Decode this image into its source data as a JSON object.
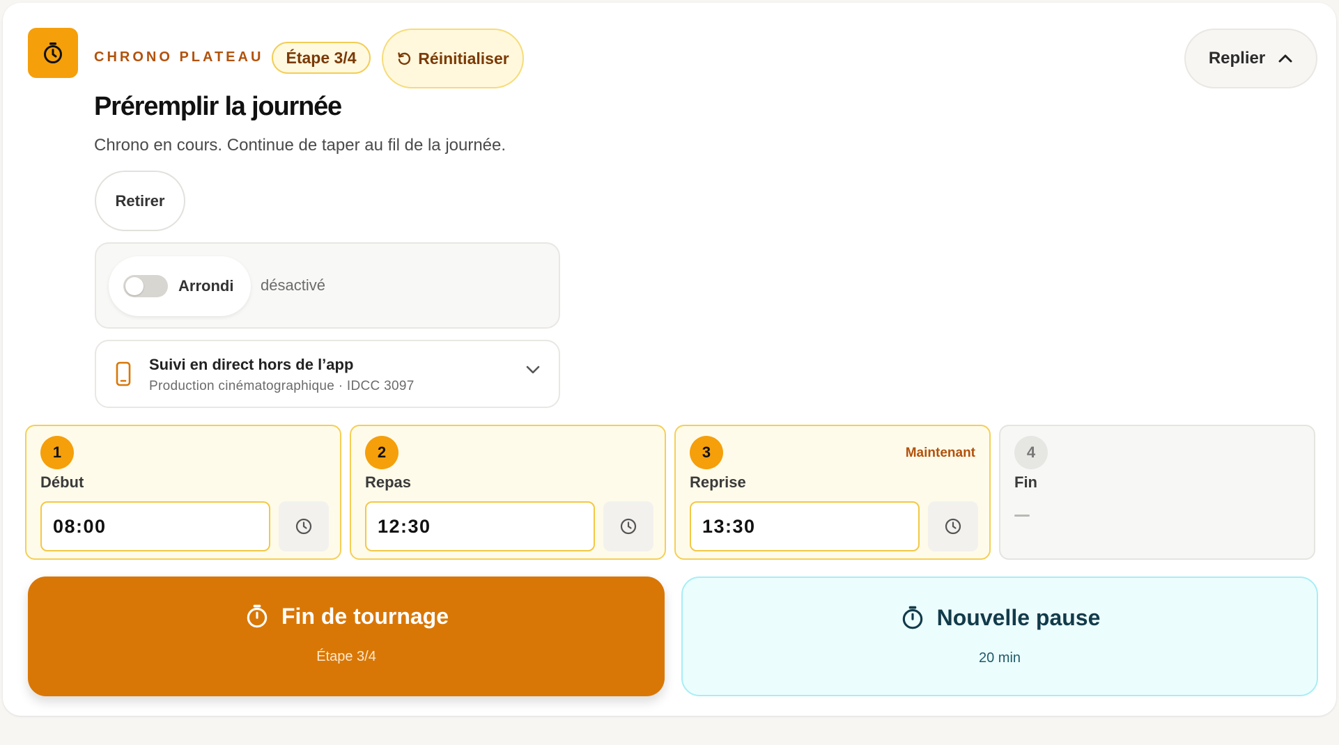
{
  "header": {
    "eyebrow": "CHRONO PLATEAU",
    "step_badge": "Étape 3/4",
    "reset_label": "Réinitialiser",
    "collapse_label": "Replier",
    "title": "Préremplir la journée",
    "subtitle": "Chrono en cours. Continue de taper au fil de la journée."
  },
  "actions": {
    "remove_label": "Retirer"
  },
  "rounding": {
    "label": "Arrondi",
    "state": "désactivé",
    "enabled": false
  },
  "live_tracking": {
    "title": "Suivi en direct hors de l’app",
    "subtitle": "Production cinématographique · IDCC 3097"
  },
  "steps": [
    {
      "number": "1",
      "label": "Début",
      "value": "08:00",
      "status": "done"
    },
    {
      "number": "2",
      "label": "Repas",
      "value": "12:30",
      "status": "done"
    },
    {
      "number": "3",
      "label": "Reprise",
      "value": "13:30",
      "status": "current",
      "badge": "Maintenant"
    },
    {
      "number": "4",
      "label": "Fin",
      "value": "—",
      "status": "pending"
    }
  ],
  "cta": {
    "end_label": "Fin de tournage",
    "end_sub": "Étape 3/4",
    "pause_label": "Nouvelle pause",
    "pause_sub": "20 min"
  },
  "colors": {
    "accent": "#f59f0b",
    "cta_end": "#d97706",
    "cta_pause_bg": "#ecfdfe",
    "eyebrow": "#b2520c"
  },
  "icons": {
    "app": "stopwatch-icon",
    "reset": "refresh-icon",
    "collapse": "chevron-up-icon",
    "phone": "phone-icon",
    "expand": "chevron-down-icon",
    "clock": "clock-icon"
  }
}
